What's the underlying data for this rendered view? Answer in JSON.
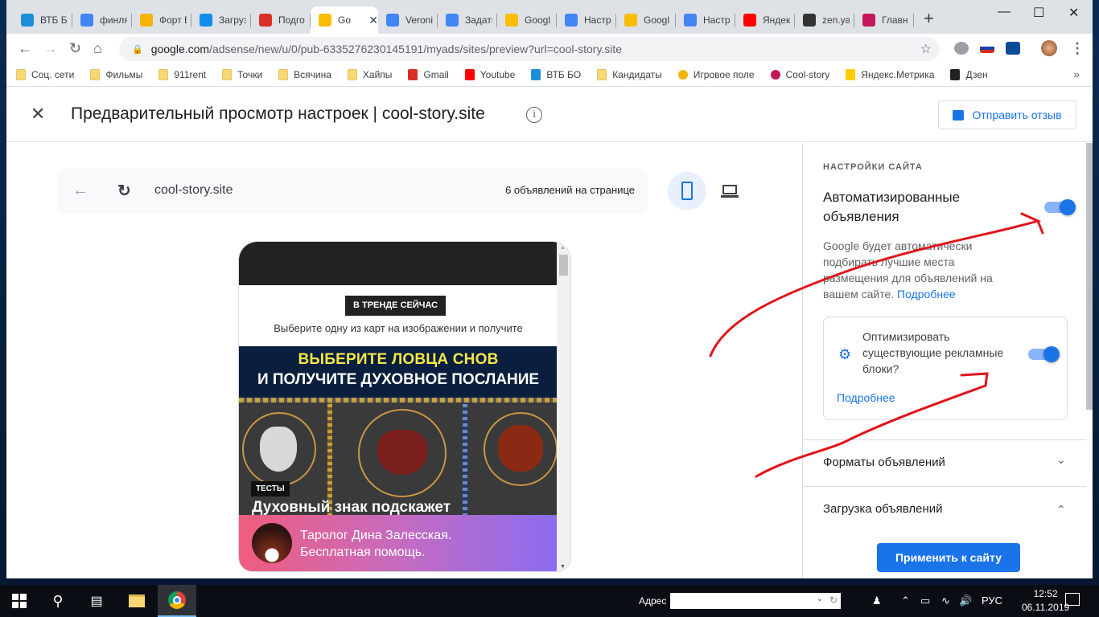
{
  "browser": {
    "tabs": [
      {
        "title": "ВТБ БО",
        "icon": "vtb-icon",
        "color": "#1f8ed8"
      },
      {
        "title": "финля",
        "icon": "google-icon",
        "color": "#4285f4"
      },
      {
        "title": "Форт Е",
        "icon": "cts-icon",
        "color": "#f4b400"
      },
      {
        "title": "Загруз",
        "icon": "teamviewer-icon",
        "color": "#0e8ee9"
      },
      {
        "title": "Подго",
        "icon": "gmail-icon",
        "color": "#d93025"
      },
      {
        "title": "Go",
        "icon": "adsense-icon",
        "color": "#fbbc04",
        "active": true
      },
      {
        "title": "Veroni",
        "icon": "google-icon",
        "color": "#4285f4"
      },
      {
        "title": "Задать",
        "icon": "google-icon",
        "color": "#4285f4"
      },
      {
        "title": "Googl",
        "icon": "adsense-icon",
        "color": "#fbbc04"
      },
      {
        "title": "Настр",
        "icon": "google-icon",
        "color": "#4285f4"
      },
      {
        "title": "Googl",
        "icon": "adsense-icon",
        "color": "#fbbc04"
      },
      {
        "title": "Настр",
        "icon": "google-icon",
        "color": "#4285f4"
      },
      {
        "title": "Яндек",
        "icon": "yandex-icon",
        "color": "#ff0000"
      },
      {
        "title": "zen.ya",
        "icon": "zen-icon",
        "color": "#333333"
      },
      {
        "title": "Главн",
        "icon": "coolstory-icon",
        "color": "#c2185b"
      }
    ],
    "new_tab": "+",
    "url_host": "google.com",
    "url_path": "/adsense/new/u/0/pub-6335276230145191/myads/sites/preview?url=cool-story.site",
    "extensions": [
      "abp-icon",
      "russian-flag-icon",
      "vtb-extension-icon",
      "profile-avatar"
    ],
    "bookmarks": [
      {
        "label": "Соц. сети",
        "icon": "folder-icon"
      },
      {
        "label": "Фильмы",
        "icon": "folder-icon"
      },
      {
        "label": "911rent",
        "icon": "folder-icon"
      },
      {
        "label": "Точки",
        "icon": "folder-icon"
      },
      {
        "label": "Всячина",
        "icon": "folder-icon"
      },
      {
        "label": "Хайпы",
        "icon": "folder-icon"
      },
      {
        "label": "Gmail",
        "icon": "gmail-icon"
      },
      {
        "label": "Youtube",
        "icon": "youtube-icon"
      },
      {
        "label": "ВТБ БО",
        "icon": "vtb-icon"
      },
      {
        "label": "Кандидаты",
        "icon": "folder-icon"
      },
      {
        "label": "Игровое поле",
        "icon": "go-icon"
      },
      {
        "label": "Cool-story",
        "icon": "coolstory-icon"
      },
      {
        "label": "Яндекс.Метрика",
        "icon": "metrika-icon"
      },
      {
        "label": "Дзен",
        "icon": "zen-icon"
      }
    ],
    "bookmarks_more": "»"
  },
  "header": {
    "title": "Предварительный просмотр настроек | cool-story.site",
    "info_glyph": "i",
    "feedback_label": "Отправить отзыв"
  },
  "preview": {
    "site": "cool-story.site",
    "ads_count": "6 объявлений на странице",
    "device_selected": "mobile",
    "page": {
      "trend_badge": "В ТРЕНДЕ СЕЙЧАС",
      "subline": "Выберите одну из карт на изображении и получите",
      "banner_line1": "ВЫБЕРИТЕ ЛОВЦА СНОВ",
      "banner_line2": "И ПОЛУЧИТЕ ДУХОВНОЕ ПОСЛАНИЕ",
      "tag": "ТЕСТЫ",
      "article_title": "Духовный знак подскажет",
      "promo_line1": "Таролог Дина Залесская.",
      "promo_line2": "Бесплатная помощь."
    }
  },
  "settings": {
    "section_label": "НАСТРОЙКИ САЙТА",
    "auto_ads_title": "Автоматизированные объявления",
    "auto_ads_enabled": true,
    "auto_ads_desc": "Google будет автоматически подбирать лучшие места размещения для объявлений на вашем сайте.",
    "learn_more": "Подробнее",
    "optimize_text": "Оптимизировать существующие рекламные блоки?",
    "optimize_enabled": true,
    "optimize_learn_more": "Подробнее",
    "accordions": [
      {
        "label": "Форматы объявлений",
        "expanded": false
      },
      {
        "label": "Загрузка объявлений",
        "expanded": true
      }
    ],
    "apply_label": "Применить к сайту",
    "accent": "#1a73e8"
  },
  "taskbar": {
    "address_label": "Адрес",
    "address_value": "",
    "lang": "РУС",
    "time": "12:52",
    "date": "06.11.2019"
  }
}
